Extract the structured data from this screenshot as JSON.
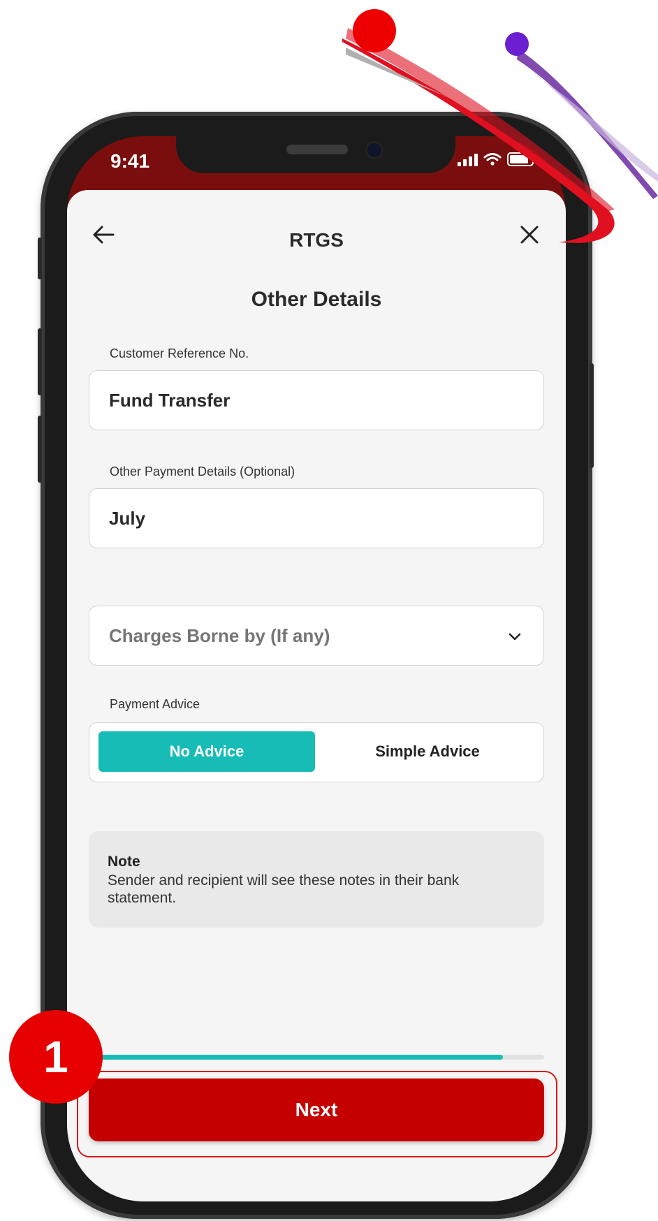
{
  "status_bar": {
    "time": "9:41"
  },
  "header": {
    "title": "RTGS",
    "back_icon": "arrow-left-icon",
    "close_icon": "close-icon"
  },
  "section_title": "Other Details",
  "fields": {
    "customer_reference": {
      "label": "Customer Reference No.",
      "value": "Fund Transfer"
    },
    "other_payment_details": {
      "label": "Other Payment Details (Optional)",
      "value": "July"
    },
    "charges_borne_by": {
      "placeholder": "Charges Borne by (If any)",
      "icon": "chevron-down-icon"
    }
  },
  "payment_advice": {
    "label": "Payment Advice",
    "options": [
      "No Advice",
      "Simple Advice"
    ],
    "selected": "No Advice"
  },
  "note": {
    "title": "Note",
    "text": "Sender and recipient will see these notes in their bank statement."
  },
  "progress": {
    "fraction": 0.91
  },
  "next_button": {
    "label": "Next"
  },
  "step_badge": {
    "number": "1"
  },
  "colors": {
    "accent_teal": "#18bcb6",
    "primary_red": "#c40000",
    "header_maroon": "#7a0e0e",
    "badge_red": "#e60000"
  }
}
